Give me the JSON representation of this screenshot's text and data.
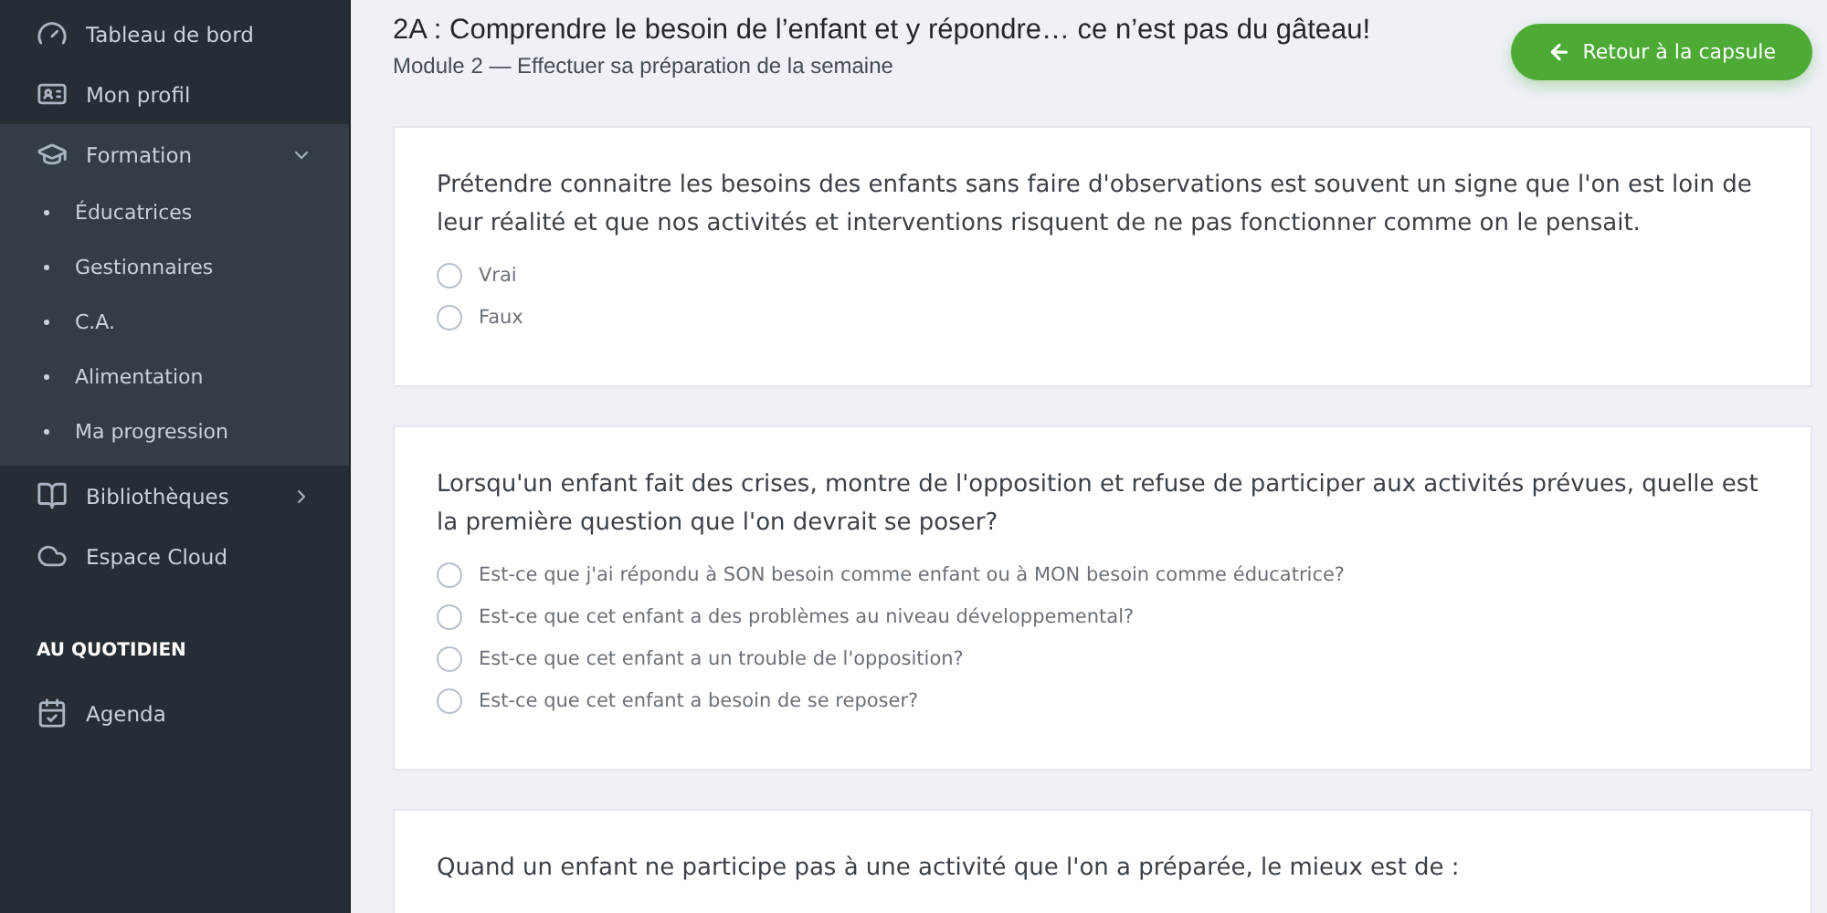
{
  "sidebar": {
    "items": [
      {
        "label": "Tableau de bord",
        "expanded": false
      },
      {
        "label": "Mon profil",
        "expanded": false
      },
      {
        "label": "Formation",
        "expanded": true,
        "children": [
          {
            "label": "Éducatrices"
          },
          {
            "label": "Gestionnaires"
          },
          {
            "label": "C.A."
          },
          {
            "label": "Alimentation"
          },
          {
            "label": "Ma progression"
          }
        ]
      },
      {
        "label": "Bibliothèques",
        "expanded": false,
        "has_children": true
      },
      {
        "label": "Espace Cloud",
        "expanded": false
      }
    ],
    "section_title": "AU QUOTIDIEN",
    "section_items": [
      {
        "label": "Agenda"
      }
    ]
  },
  "header": {
    "title": "2A : Comprendre le besoin de l’enfant et y répondre… ce n’est pas du gâteau!",
    "subtitle": "Module 2 — Effectuer sa préparation de la semaine",
    "back_button": "Retour à la capsule"
  },
  "questions": [
    {
      "text": "Prétendre connaitre les besoins des enfants sans faire d'observations est souvent un signe que l'on est loin de leur réalité et que nos activités et interventions risquent de ne pas fonctionner comme on le pensait.",
      "options": [
        {
          "label": "Vrai",
          "selected": false
        },
        {
          "label": "Faux",
          "selected": false
        }
      ]
    },
    {
      "text": "Lorsqu'un enfant fait des crises, montre de l'opposition et refuse de participer aux activités prévues, quelle est la première question que l'on devrait se poser?",
      "options": [
        {
          "label": "Est-ce que j'ai répondu à SON besoin comme enfant ou à MON besoin comme éducatrice?",
          "selected": false
        },
        {
          "label": "Est-ce que cet enfant a des problèmes au niveau développemental?",
          "selected": false
        },
        {
          "label": "Est-ce que cet enfant a un trouble de l'opposition?",
          "selected": false
        },
        {
          "label": "Est-ce que cet enfant a besoin de se reposer?",
          "selected": false
        }
      ]
    },
    {
      "text": "Quand un enfant ne participe pas à une activité que l'on a préparée, le mieux est de :"
    }
  ]
}
